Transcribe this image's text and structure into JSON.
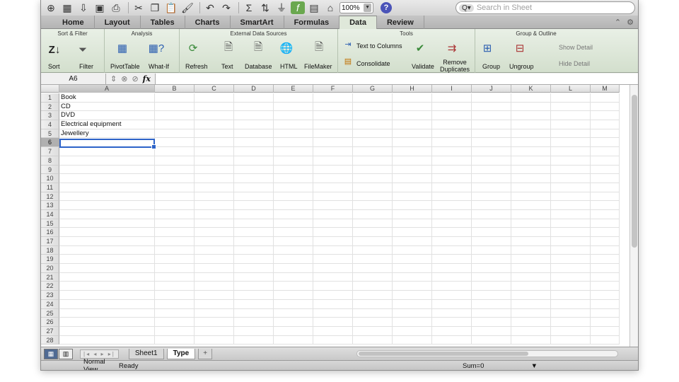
{
  "search": {
    "placeholder": "Search in Sheet"
  },
  "toolbar": {
    "zoom": "100%"
  },
  "tabs": [
    {
      "label": "Home",
      "active": false
    },
    {
      "label": "Layout",
      "active": false
    },
    {
      "label": "Tables",
      "active": false
    },
    {
      "label": "Charts",
      "active": false
    },
    {
      "label": "SmartArt",
      "active": false
    },
    {
      "label": "Formulas",
      "active": false
    },
    {
      "label": "Data",
      "active": true
    },
    {
      "label": "Review",
      "active": false
    }
  ],
  "ribbon": {
    "groups": {
      "sort_filter": "Sort & Filter",
      "analysis": "Analysis",
      "external": "External Data Sources",
      "tools": "Tools",
      "group_outline": "Group & Outline"
    },
    "buttons": {
      "sort": "Sort",
      "filter": "Filter",
      "pivottable": "PivotTable",
      "whatif": "What-If",
      "refresh": "Refresh",
      "text": "Text",
      "database": "Database",
      "html": "HTML",
      "filemaker": "FileMaker",
      "text_to_columns": "Text to Columns",
      "consolidate": "Consolidate",
      "validate": "Validate",
      "remove_duplicates_1": "Remove",
      "remove_duplicates_2": "Duplicates",
      "group": "Group",
      "ungroup": "Ungroup",
      "show_detail": "Show Detail",
      "hide_detail": "Hide Detail"
    }
  },
  "formula_bar": {
    "name_box": "A6",
    "fx": "fx",
    "value": ""
  },
  "columns": [
    "A",
    "B",
    "C",
    "D",
    "E",
    "F",
    "G",
    "H",
    "I",
    "J",
    "K",
    "L",
    "M"
  ],
  "rows": [
    "1",
    "2",
    "3",
    "4",
    "5",
    "6",
    "7",
    "8",
    "9",
    "10",
    "11",
    "12",
    "13",
    "14",
    "15",
    "16",
    "17",
    "18",
    "19",
    "20",
    "21",
    "22",
    "23",
    "24",
    "25",
    "26",
    "27",
    "28"
  ],
  "cells_a": [
    "Book",
    "CD",
    "DVD",
    "Electrical equipment",
    "Jewellery"
  ],
  "sheets": [
    {
      "label": "Sheet1",
      "active": false
    },
    {
      "label": "Type",
      "active": true
    }
  ],
  "sheet_add": "+",
  "status": {
    "view": "Normal View",
    "ready": "Ready",
    "sum": "Sum=0"
  },
  "colors": {
    "accent": "#2d63c8",
    "ribbon": "#dfe8da"
  }
}
